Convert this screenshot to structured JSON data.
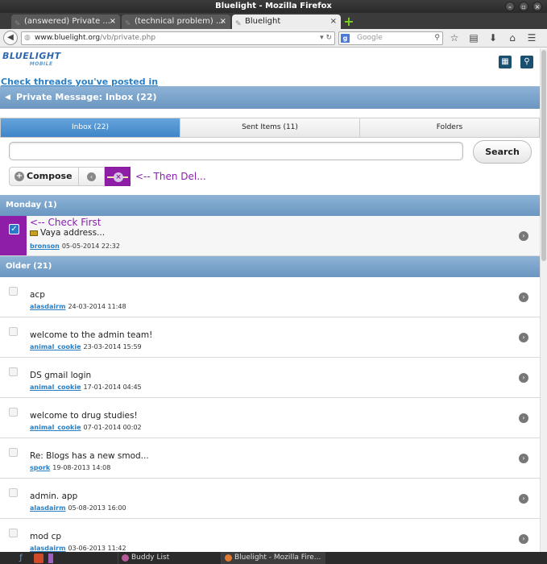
{
  "window": {
    "title": "Bluelight - Mozilla Firefox"
  },
  "tabs": [
    {
      "label": "(answered) Private ...",
      "active": false
    },
    {
      "label": "(technical problem) ...",
      "active": false
    },
    {
      "label": "Bluelight",
      "active": true
    }
  ],
  "nav": {
    "url_host": "www.bluelight.org",
    "url_path": "/vb/private.php",
    "search_placeholder": "Google",
    "search_engine_letter": "g"
  },
  "site": {
    "logo_main": "BLUELIGHT",
    "logo_sub": "MOBILE",
    "check_threads_link": "Check threads you've posted in",
    "pm_title": "Private Message: Inbox (22)"
  },
  "folder_tabs": [
    {
      "label": "Inbox (22)",
      "active": true
    },
    {
      "label": "Sent Items (11)",
      "active": false
    },
    {
      "label": "Folders",
      "active": false
    }
  ],
  "search": {
    "value": "",
    "button_label": "Search"
  },
  "actions": {
    "compose_label": "Compose",
    "delete_annotation": "<-- Then Del..."
  },
  "sections": {
    "monday": "Monday (1)",
    "older": "Older (21)"
  },
  "first_message": {
    "annotation": "<-- Check First",
    "subject": "Vaya address...",
    "author": "bronson",
    "date": "05-05-2014 22:32",
    "checked": true
  },
  "older_messages": [
    {
      "subject": "acp",
      "author": "alasdairm",
      "date": "24-03-2014 11:48"
    },
    {
      "subject": "welcome to the admin team!",
      "author": "animal_cookie",
      "date": "23-03-2014 15:59"
    },
    {
      "subject": "DS gmail login",
      "author": "animal_cookie",
      "date": "17-01-2014 04:45"
    },
    {
      "subject": "welcome to drug studies!",
      "author": "animal_cookie",
      "date": "07-01-2014 00:02"
    },
    {
      "subject": "Re: Blogs has a new smod...",
      "author": "spork",
      "date": "19-08-2013 14:08"
    },
    {
      "subject": "admin. app",
      "author": "alasdairm",
      "date": "05-08-2013 16:00"
    },
    {
      "subject": "mod cp",
      "author": "alasdairm",
      "date": "03-06-2013 11:42"
    }
  ],
  "taskbar": {
    "items": [
      {
        "label": "Buddy List"
      },
      {
        "label": "Bluelight - Mozilla Fire..."
      }
    ]
  }
}
